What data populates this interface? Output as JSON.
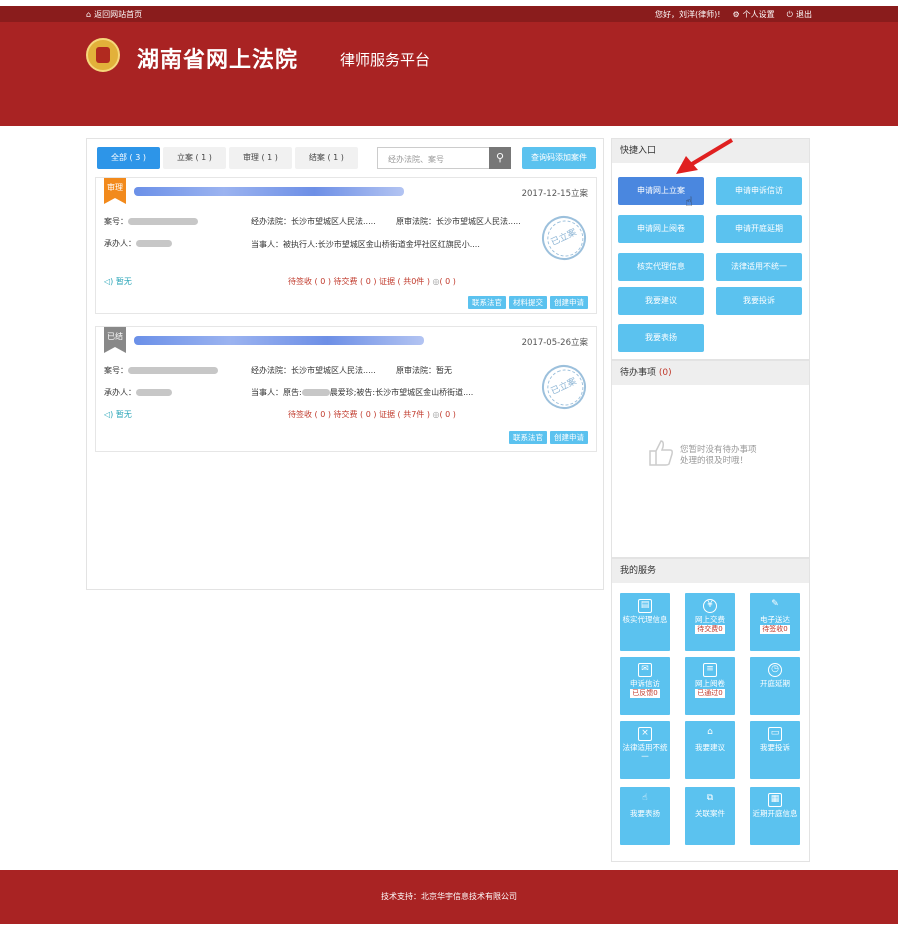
{
  "topbar": {
    "home_link": "返回网站首页",
    "greeting": "您好，刘洋(律师)!",
    "settings": "个人设置",
    "logout": "退出"
  },
  "header": {
    "title": "湖南省网上法院",
    "subtitle": "律师服务平台"
  },
  "tabs": [
    {
      "label": "全部 ( 3 )",
      "active": true
    },
    {
      "label": "立案 ( 1 )"
    },
    {
      "label": "审理 ( 1 )"
    },
    {
      "label": "结案 ( 1 )"
    }
  ],
  "search": {
    "placeholder": "经办法院、案号"
  },
  "add_case_button": "查询码添加案件",
  "cases": [
    {
      "status": "审理",
      "date": "2017-12-15立案",
      "case_no_label": "案号：",
      "handler_label": "承办人：",
      "court_label": "经办法院：长沙市望城区人民法.....",
      "orig_court_label": "原审法院：长沙市望城区人民法.....",
      "parties": "当事人：被执行人:长沙市望城区金山桥街道金坪社区红旗民小....",
      "seal": "已立案",
      "notice": "暂无",
      "stats": "待签收 ( 0 )  待交费 ( 0 )  证据 ( 共0件 )",
      "messages": "( 0 )",
      "actions": [
        "联系法官",
        "材料提交",
        "创建申请"
      ]
    },
    {
      "status": "已结",
      "date": "2017-05-26立案",
      "case_no_label": "案号：",
      "handler_label": "承办人：",
      "court_label": "经办法院：长沙市望城区人民法.....",
      "orig_court_label": "原审法院：暂无",
      "parties_prefix": "当事人：原告:",
      "parties_suffix": "晨爱珍;被告:长沙市望城区金山桥街道....",
      "seal": "已立案",
      "notice": "暂无",
      "stats": "待签收 ( 0 )  待交费 ( 0 )  证据 ( 共7件 )",
      "messages": "( 0 )",
      "actions": [
        "联系法官",
        "创建申请"
      ]
    }
  ],
  "quick_entry": {
    "title": "快捷入口",
    "buttons": [
      "申请网上立案",
      "申请申诉信访",
      "申请网上阅卷",
      "申请开庭延期",
      "核实代理信息",
      "法律适用不统一",
      "我要建议",
      "我要投诉",
      "我要表扬"
    ]
  },
  "todo": {
    "title": "待办事项",
    "count": "(0)",
    "empty_line1": "您暂时没有待办事项",
    "empty_line2": "处理的很及时哦！"
  },
  "services": {
    "title": "我的服务",
    "items": [
      {
        "label": "核实代理信息",
        "icon": "id-card-icon"
      },
      {
        "label": "网上交费",
        "sub": "待交费0",
        "icon": "yen-icon"
      },
      {
        "label": "电子送达",
        "sub": "待签收0",
        "icon": "pen-icon"
      },
      {
        "label": "申诉信访",
        "sub": "已反馈0",
        "icon": "mail-icon"
      },
      {
        "label": "网上阅卷",
        "sub": "已通过0",
        "icon": "document-icon"
      },
      {
        "label": "开庭延期",
        "icon": "clock-icon"
      },
      {
        "label": "法律适用不统一",
        "icon": "x-box-icon"
      },
      {
        "label": "我要建议",
        "icon": "edit-icon"
      },
      {
        "label": "我要投诉",
        "icon": "chat-icon"
      },
      {
        "label": "我要表扬",
        "icon": "thumbs-up-icon"
      },
      {
        "label": "关联案件",
        "icon": "link-icon"
      },
      {
        "label": "近期开庭信息",
        "icon": "calendar-icon"
      }
    ]
  },
  "footer": {
    "text": "技术支持：北京华宇信息技术有限公司"
  }
}
